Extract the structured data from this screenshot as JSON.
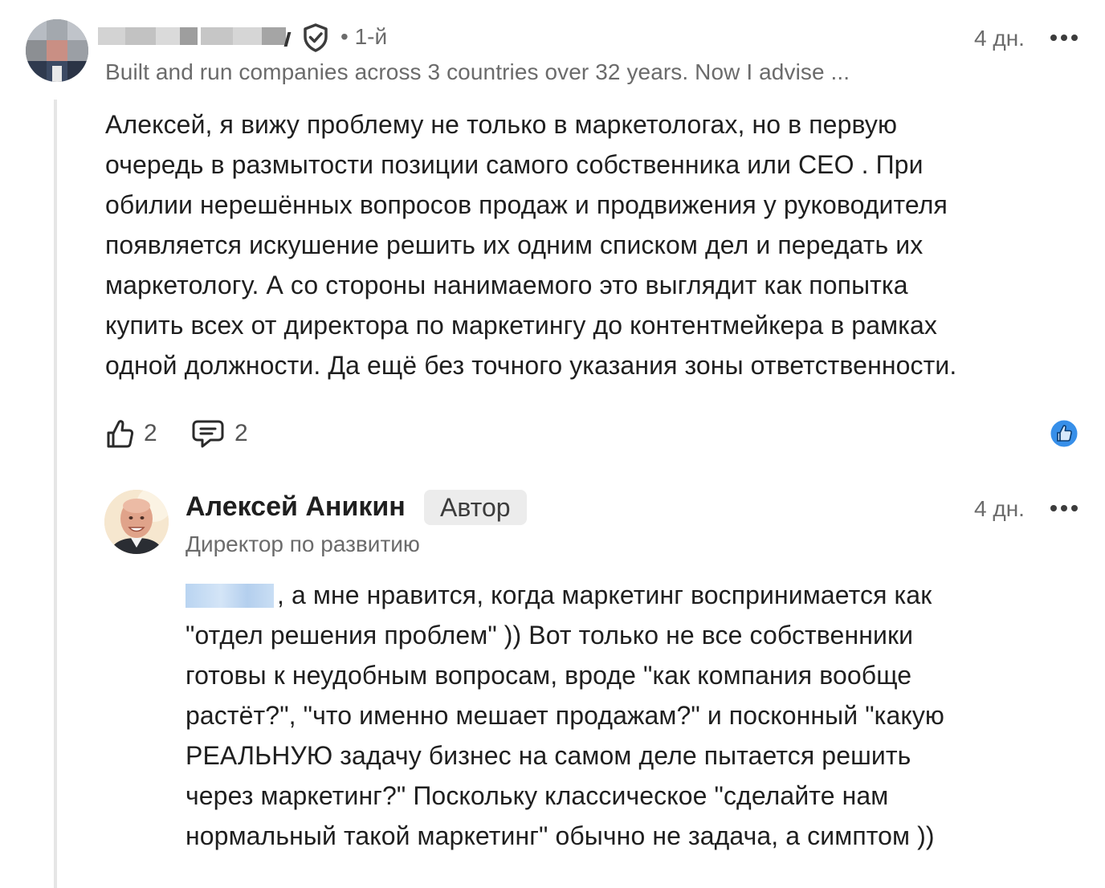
{
  "comment": {
    "author_name": "",
    "connection_degree": "• 1-й",
    "headline": "Built and run companies across 3 countries over 32 years. Now I advise ...",
    "time": "4 дн.",
    "text_lines": [
      "Алексей, я вижу проблему не только в маркетологах, но в первую",
      "очередь в размытости позиции самого собственника или CEO . При",
      "обилии нерешённых вопросов продаж и продвижения у руководителя",
      "появляется искушение решить их одним списком дел и передать их",
      "маркетологу. А со стороны нанимаемого это выглядит как попытка",
      "купить всех от директора по маркетингу до контентмейкера в рамках",
      "одной должности. Да ещё без точного указания зоны ответственности."
    ],
    "like_count": "2",
    "reply_count": "2",
    "reaction": "like-reaction-icon"
  },
  "reply": {
    "author_name": "Алексей Аникин",
    "author_badge": "Автор",
    "headline": "Директор по развитию",
    "time": "4 дн.",
    "first_line_after_mention": ", а мне нравится, когда маркетинг воспринимается как",
    "text_lines": [
      "\"отдел решения проблем\" )) Вот только не все собственники",
      "готовы к неудобным вопросам, вроде \"как компания вообще",
      "растёт?\", \"что именно мешает продажам?\" и посконный \"какую",
      "РЕАЛЬНУЮ задачу бизнес на самом деле пытается решить",
      "через маркетинг?\" Поскольку классическое \"сделайте нам",
      "нормальный такой маркетинг\" обычно не задача, а симптом ))"
    ]
  },
  "colors": {
    "text": "#1f1f1f",
    "muted": "#6b6b6b",
    "badge_bg": "#ececec",
    "reaction_blue": "#378fe9",
    "thread_line": "#e6e6e6"
  }
}
